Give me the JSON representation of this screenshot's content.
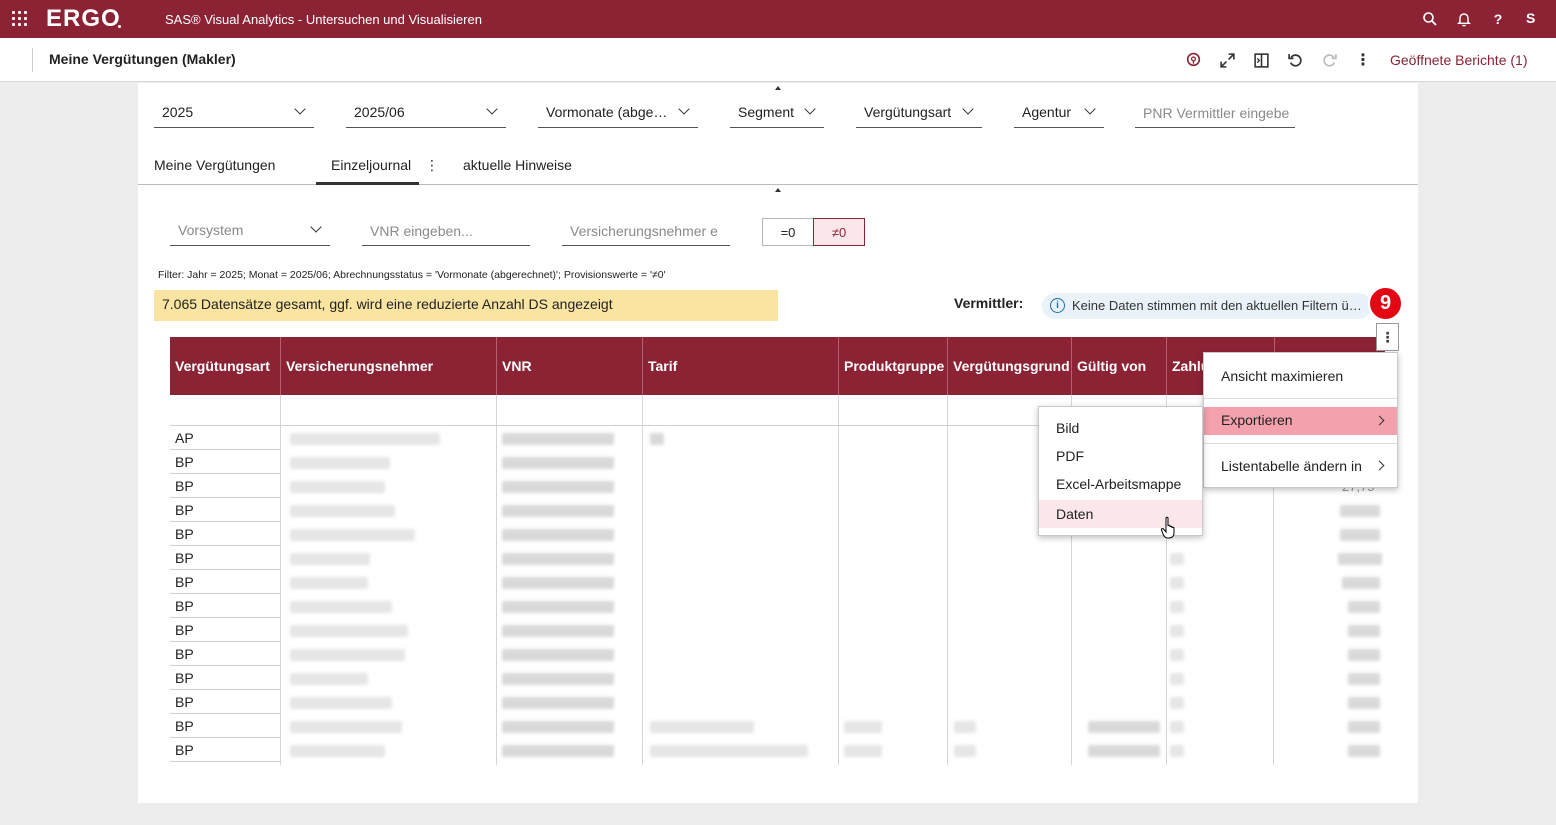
{
  "appbar": {
    "logo": "ERGO",
    "title": "SAS® Visual Analytics - Untersuchen und Visualisieren",
    "user_initial": "S",
    "icons": [
      "apps-grid-icon",
      "search-icon",
      "bell-icon",
      "help-icon"
    ]
  },
  "header": {
    "report_title": "Meine Vergütungen (Makler)",
    "open_reports": "Geöffnete Berichte (1)",
    "toolbar_icons": [
      "pin-location-icon",
      "expand-icon",
      "panel-icon",
      "undo-icon",
      "redo-icon",
      "more-vert-icon"
    ]
  },
  "filters": {
    "jahr": "2025",
    "monat": "2025/06",
    "abrechnungsstatus": "Vormonate (abge…",
    "segment": "Segment",
    "verguetungsart": "Vergütungsart",
    "agentur": "Agentur",
    "pnr_placeholder": "PNR Vermittler eingebe"
  },
  "tabs": {
    "tab1": "Meine Vergütungen",
    "tab2": "Einzeljournal",
    "tab3": "aktuelle Hinweise"
  },
  "subfilters": {
    "vorsystem": "Vorsystem",
    "vnr_placeholder": "VNR eingeben...",
    "vn_placeholder": "Versicherungsnehmer e",
    "toggle_eq": "=0",
    "toggle_neq": "≠0"
  },
  "filter_summary": "Filter: Jahr = 2025; Monat = 2025/06; Abrechnungsstatus = 'Vormonate (abgerechnet)'; Provisionswerte = '≠0'",
  "record_banner": "7.065  Datensätze gesamt, ggf. wird eine reduzierte Anzahl DS angezeigt",
  "vermittler": {
    "label": "Vermittler:",
    "info": "Keine Daten stimmen mit den aktuellen Filtern ü…"
  },
  "step_badge": "9",
  "table": {
    "columns": [
      "Vergütungsart",
      "Versicherungsnehmer",
      "VNR",
      "Tarif",
      "Produktgruppe",
      "Vergütungsgrund",
      "Gültig von",
      "Zahlu"
    ],
    "rows": [
      "AP",
      "BP",
      "BP",
      "BP",
      "BP",
      "BP",
      "BP",
      "BP",
      "BP",
      "BP",
      "BP",
      "BP",
      "BP",
      "BP"
    ],
    "partial_value": "27,75"
  },
  "menu_main": {
    "items": [
      "Ansicht maximieren",
      "Exportieren",
      "Listentabelle ändern in"
    ],
    "highlight_color": "#f2a1ad"
  },
  "menu_export": {
    "items": [
      "Bild",
      "PDF",
      "Excel-Arbeitsmappe",
      "Daten"
    ],
    "hover_color": "#fbe7ea"
  },
  "colors": {
    "brand": "#8c2335",
    "banner": "#f9e4a1",
    "badge": "#e30613"
  }
}
